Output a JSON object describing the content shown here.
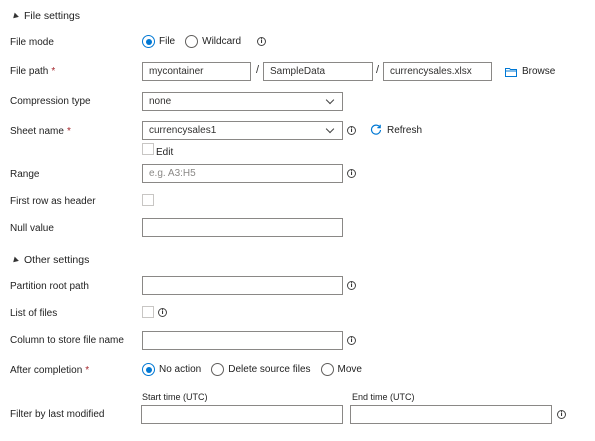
{
  "sections": {
    "file_settings": "File settings",
    "other_settings": "Other settings"
  },
  "file_mode": {
    "label": "File mode",
    "options": [
      "File",
      "Wildcard"
    ],
    "selected": "File"
  },
  "file_path": {
    "label": "File path",
    "required_mark": "*",
    "container": "mycontainer",
    "directory": "SampleData",
    "file": "currencysales.xlsx",
    "separator": "/",
    "browse_label": "Browse"
  },
  "compression": {
    "label": "Compression type",
    "value": "none"
  },
  "sheet_name": {
    "label": "Sheet name",
    "required_mark": "*",
    "value": "currencysales1",
    "refresh_label": "Refresh",
    "edit_label": "Edit"
  },
  "range": {
    "label": "Range",
    "placeholder": "e.g. A3:H5"
  },
  "first_row_header": {
    "label": "First row as header"
  },
  "null_value": {
    "label": "Null value"
  },
  "partition_root": {
    "label": "Partition root path"
  },
  "list_of_files": {
    "label": "List of files"
  },
  "column_file_name": {
    "label": "Column to store file name"
  },
  "after_completion": {
    "label": "After completion",
    "required_mark": "*",
    "options": [
      "No action",
      "Delete source files",
      "Move"
    ],
    "selected": "No action"
  },
  "filter_modified": {
    "label": "Filter by last modified",
    "start_label": "Start time (UTC)",
    "end_label": "End time (UTC)"
  },
  "icons": {
    "info": "info-icon",
    "folder": "folder-icon",
    "refresh": "refresh-icon",
    "collapse": "collapse-triangle-icon"
  },
  "colors": {
    "accent": "#0078d4",
    "required": "#a4262c",
    "border": "#8a8886"
  }
}
